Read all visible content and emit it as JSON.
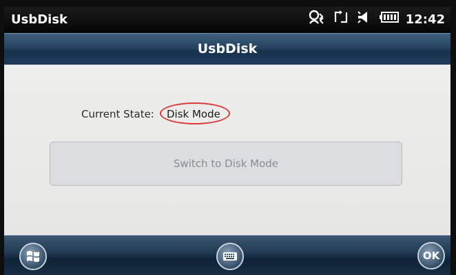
{
  "statusbar": {
    "app_name": "UsbDisk",
    "time": "12:42",
    "icons": [
      "connectivity-icon",
      "sync-icon",
      "volume-muted-icon",
      "battery-icon"
    ]
  },
  "titlebar": {
    "title": "UsbDisk"
  },
  "main": {
    "state_label": "Current State:",
    "state_value": "Disk Mode",
    "switch_button_label": "Switch to Disk Mode"
  },
  "softkeys": {
    "ok_label": "OK"
  }
}
